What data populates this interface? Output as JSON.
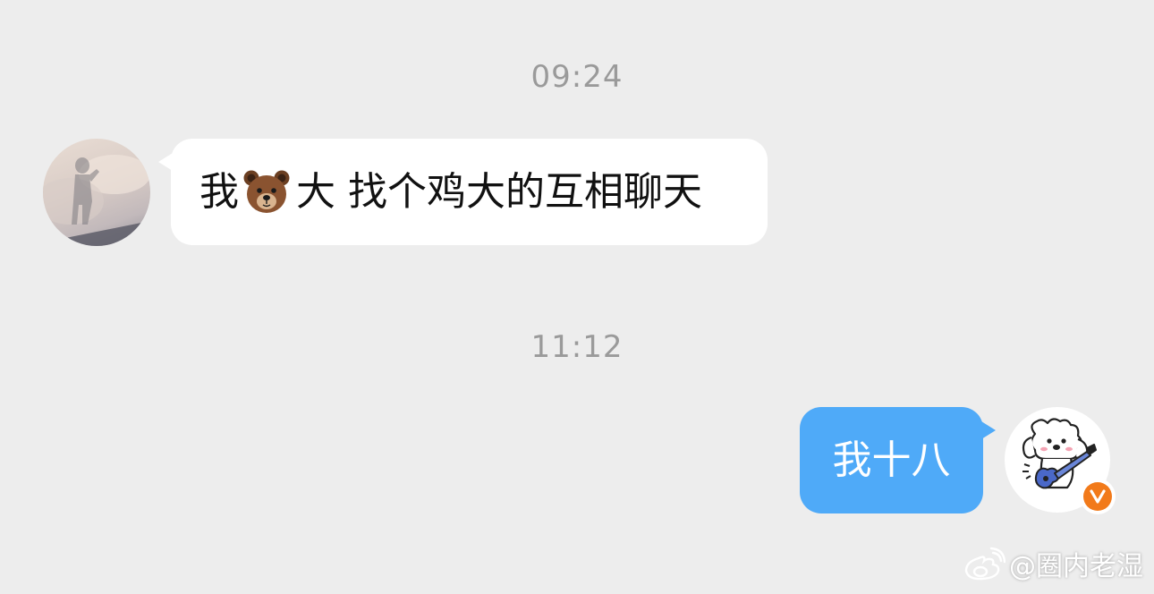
{
  "timestamps": {
    "first": "09:24",
    "second": "11:12"
  },
  "messages": {
    "incoming": {
      "prefix": "我",
      "emoji": "bear-face",
      "suffix": "大 找个鸡大的互相聊天"
    },
    "outgoing": {
      "text": "我十八"
    }
  },
  "avatars": {
    "left": "avatar-silhouette-photo",
    "right": "dog-playing-guitar"
  },
  "badge": {
    "icon": "verified-v-icon",
    "color": "#f27a1a"
  },
  "watermark": {
    "text": "@圈内老湿",
    "icon": "weibo-logo-icon"
  },
  "colors": {
    "background": "#ededed",
    "incoming_bubble": "#ffffff",
    "outgoing_bubble": "#4faaf8",
    "timestamp": "#9a9a9a"
  }
}
